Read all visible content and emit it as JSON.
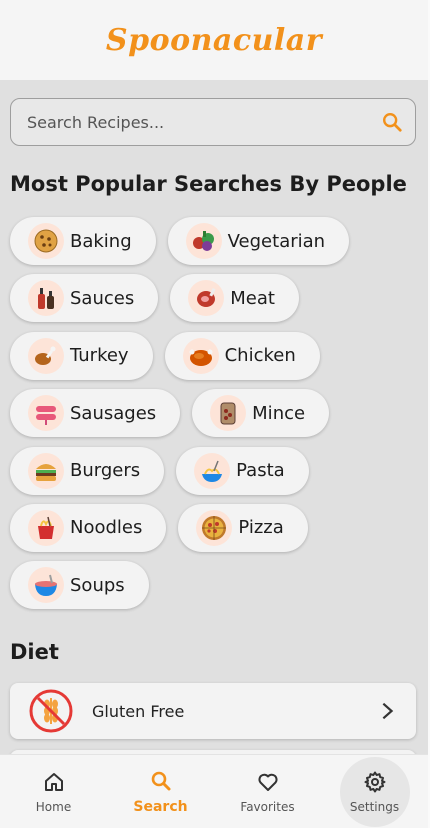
{
  "app": {
    "title": "Spoonacular",
    "brand_color": "#f2911b"
  },
  "search": {
    "placeholder": "Search Recipes..."
  },
  "popular": {
    "title": "Most Popular Searches By People",
    "rows": [
      [
        {
          "label": "Baking",
          "icon": "cookie-icon"
        },
        {
          "label": "Vegetarian",
          "icon": "vegetables-icon"
        }
      ],
      [
        {
          "label": "Sauces",
          "icon": "sauce-bottles-icon"
        },
        {
          "label": "Meat",
          "icon": "meat-icon"
        }
      ],
      [
        {
          "label": "Turkey",
          "icon": "turkey-leg-icon"
        },
        {
          "label": "Chicken",
          "icon": "roast-chicken-icon"
        }
      ],
      [
        {
          "label": "Sausages",
          "icon": "sausages-icon"
        },
        {
          "label": "Mince",
          "icon": "mince-board-icon"
        }
      ],
      [
        {
          "label": "Burgers",
          "icon": "burger-icon"
        },
        {
          "label": "Pasta",
          "icon": "pasta-icon"
        }
      ],
      [
        {
          "label": "Noodles",
          "icon": "noodles-box-icon"
        },
        {
          "label": "Pizza",
          "icon": "pizza-icon"
        }
      ],
      [
        {
          "label": "Soups",
          "icon": "soup-bowl-icon"
        }
      ]
    ]
  },
  "diet": {
    "title": "Diet",
    "items": [
      {
        "label": "Gluten Free",
        "icon": "gluten-free-icon"
      }
    ]
  },
  "nav": {
    "items": [
      {
        "label": "Home",
        "icon": "home-icon",
        "active": false
      },
      {
        "label": "Search",
        "icon": "search-icon",
        "active": true
      },
      {
        "label": "Favorites",
        "icon": "heart-icon",
        "active": false
      },
      {
        "label": "Settings",
        "icon": "gear-icon",
        "active": false
      }
    ]
  }
}
